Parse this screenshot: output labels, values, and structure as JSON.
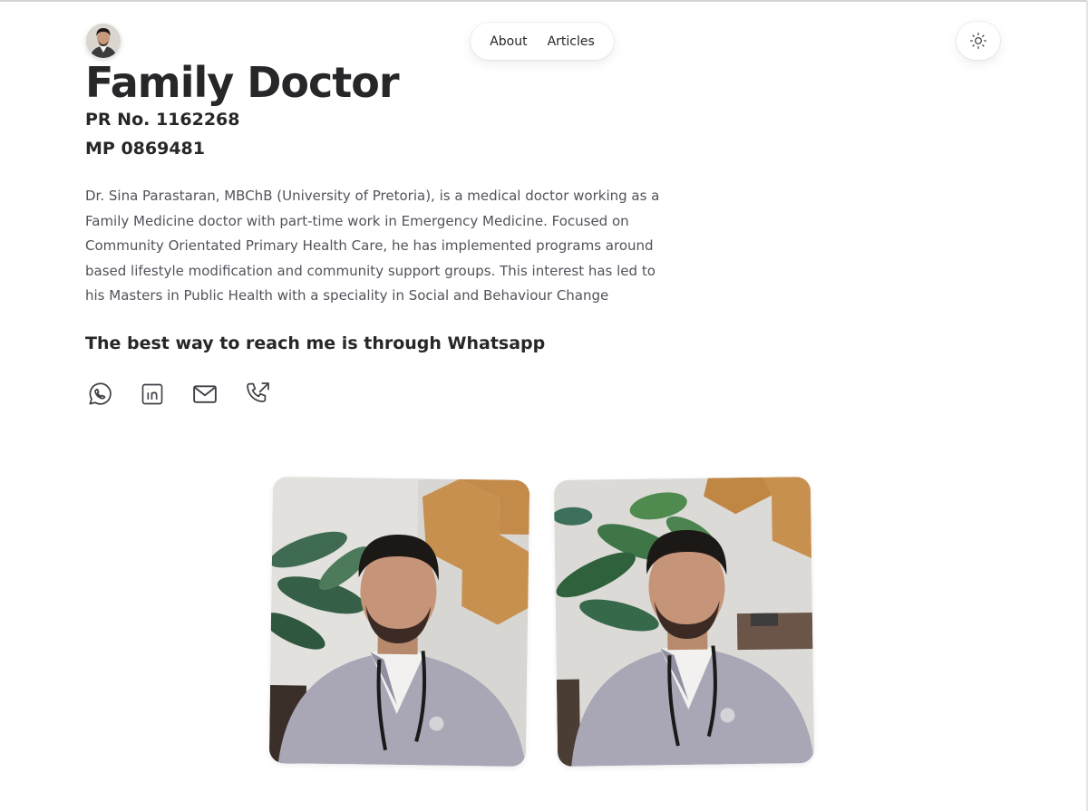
{
  "header": {
    "avatar_icon": "doctor-avatar",
    "nav": [
      {
        "label": "About"
      },
      {
        "label": "Articles"
      }
    ],
    "theme_toggle_icon": "sun-icon"
  },
  "profile": {
    "title": "Family Doctor",
    "pr_number": "PR No. 1162268",
    "mp_number": "MP 0869481",
    "bio": "Dr. Sina Parastaran, MBChB (University of Pretoria), is a medical doctor working as a Family Medicine doctor with part-time work in Emergency Medicine. Focused on Community Orientated Primary Health Care, he has implemented programs around based lifestyle modification and community support groups. This interest has led to his Masters in Public Health with a speciality in Social and Behaviour Change",
    "reach_text": "The best way to reach me is through Whatsapp"
  },
  "social": [
    {
      "icon": "whatsapp-icon"
    },
    {
      "icon": "linkedin-icon"
    },
    {
      "icon": "mail-icon"
    },
    {
      "icon": "phone-outgoing-icon"
    }
  ],
  "photos": [
    {
      "icon": "doctor-photo"
    },
    {
      "icon": "doctor-photo"
    }
  ],
  "colors": {
    "text": "#27272a",
    "muted": "#52525b",
    "wood": "#c8904f",
    "scrubs": "#a9a6b6"
  }
}
